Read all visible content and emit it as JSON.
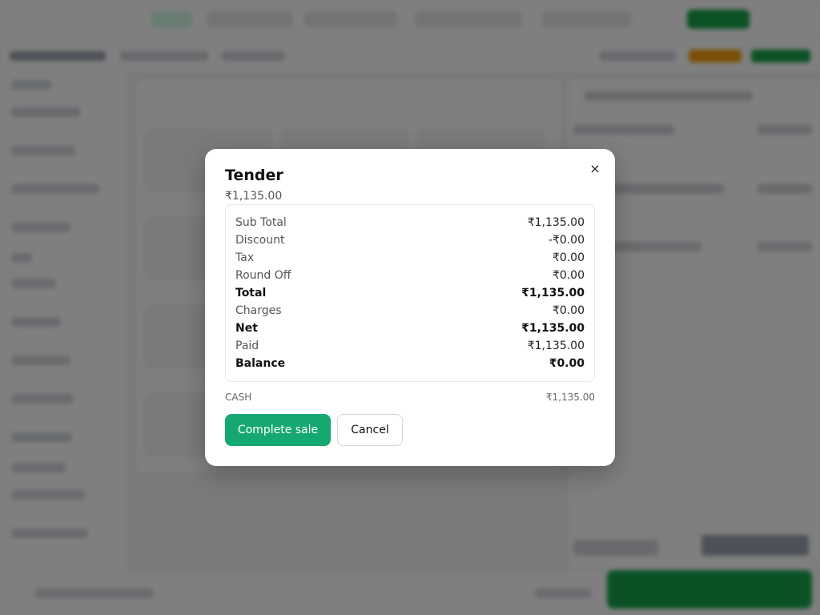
{
  "modal": {
    "title": "Tender",
    "amount": "₹1,135.00",
    "close_icon": "×",
    "summary": [
      {
        "label": "Sub Total",
        "value": "₹1,135.00",
        "bold": false
      },
      {
        "label": "Discount",
        "value": "-₹0.00",
        "bold": false
      },
      {
        "label": "Tax",
        "value": "₹0.00",
        "bold": false
      },
      {
        "label": "Round Off",
        "value": "₹0.00",
        "bold": false
      },
      {
        "label": "Total",
        "value": "₹1,135.00",
        "bold": true
      },
      {
        "label": "Charges",
        "value": "₹0.00",
        "bold": false
      },
      {
        "label": "Net",
        "value": "₹1,135.00",
        "bold": true
      },
      {
        "label": "Paid",
        "value": "₹1,135.00",
        "bold": false
      },
      {
        "label": "Balance",
        "value": "₹0.00",
        "bold": true
      }
    ],
    "payment": {
      "method": "CASH",
      "amount": "₹1,135.00"
    },
    "complete_label": "Complete sale",
    "cancel_label": "Cancel"
  },
  "colors": {
    "primary": "#16a871",
    "overlay": "rgba(0,0,0,0.5)"
  }
}
